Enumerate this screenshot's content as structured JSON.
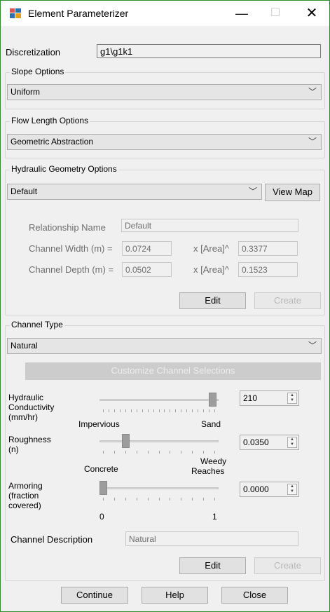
{
  "window": {
    "title": "Element Parameterizer",
    "icon": "app-grid-icon",
    "minimize_glyph": "—",
    "maximize_glyph": "☐",
    "close_glyph": "✕",
    "border_color": "#2e8b2e"
  },
  "discretization": {
    "label": "Discretization",
    "value": "g1\\g1k1"
  },
  "slope": {
    "group_title": "Slope Options",
    "selected": "Uniform"
  },
  "flow_length": {
    "group_title": "Flow Length Options",
    "selected": "Geometric Abstraction"
  },
  "hydraulic": {
    "group_title": "Hydraulic Geometry Options",
    "selected": "Default",
    "view_map_label": "View Map",
    "relationship_name_label": "Relationship Name",
    "relationship_name_value": "Default",
    "channel_width_label": "Channel Width (m) =",
    "channel_width_value": "0.0724",
    "channel_width_exp_label": "x [Area]^",
    "channel_width_exp_value": "0.3377",
    "channel_depth_label": "Channel Depth (m) =",
    "channel_depth_value": "0.0502",
    "channel_depth_exp_label": "x [Area]^",
    "channel_depth_exp_value": "0.1523",
    "edit_label": "Edit",
    "create_label": "Create"
  },
  "channel": {
    "group_title": "Channel Type",
    "selected": "Natural",
    "customize_label": "Customize Channel Selections",
    "hydraulic_conductivity": {
      "label_line1": "Hydraulic",
      "label_line2": "Conductivity",
      "label_line3": "(mm/hr)",
      "min_label": "Impervious",
      "max_label": "Sand",
      "value": "210",
      "slider_fraction": 0.98
    },
    "roughness": {
      "label_line1": "Roughness",
      "label_line2": "(n)",
      "min_label": "Concrete",
      "max_label_line1": "Weedy",
      "max_label_line2": "Reaches",
      "value": "0.0350",
      "slider_fraction": 0.2
    },
    "armoring": {
      "label_line1": "Armoring",
      "label_line2": "(fraction",
      "label_line3": "covered)",
      "min_label": "0",
      "max_label": "1",
      "value": "0.0000",
      "slider_fraction": 0.0
    },
    "description_label": "Channel Description",
    "description_value": "Natural",
    "edit_label": "Edit",
    "create_label": "Create"
  },
  "footer": {
    "continue_label": "Continue",
    "help_label": "Help",
    "close_label": "Close"
  }
}
